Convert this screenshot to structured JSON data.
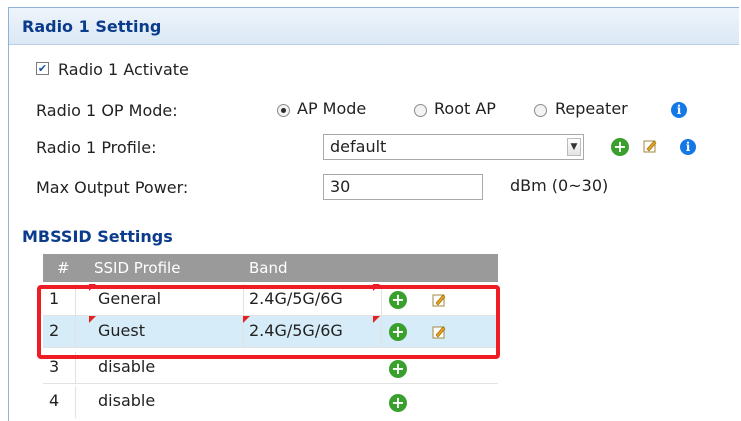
{
  "radio_setting": {
    "title": "Radio 1 Setting",
    "activate_label": "Radio 1 Activate",
    "activate_checked": true,
    "op_mode_label": "Radio 1 OP Mode:",
    "op_mode_options": [
      "AP Mode",
      "Root AP",
      "Repeater"
    ],
    "op_mode_selected": "AP Mode",
    "profile_label": "Radio 1 Profile:",
    "profile_value": "default",
    "power_label": "Max Output Power:",
    "power_value": "30",
    "power_unit": "dBm (0~30)"
  },
  "mbssid": {
    "title": "MBSSID Settings",
    "columns": [
      "#",
      "SSID Profile",
      "Band"
    ],
    "rows": [
      {
        "num": "1",
        "profile": "General",
        "band": "2.4G/5G/6G"
      },
      {
        "num": "2",
        "profile": "Guest",
        "band": "2.4G/5G/6G"
      },
      {
        "num": "3",
        "profile": "disable",
        "band": ""
      },
      {
        "num": "4",
        "profile": "disable",
        "band": ""
      }
    ]
  },
  "colors": {
    "title_blue": "#0b3c8c",
    "info_blue": "#1478e6",
    "add_green": "#3aa02d",
    "highlight_red": "#ee1c25",
    "selected_row": "#d6ecf8"
  },
  "icons": [
    "checkbox-icon",
    "radio-icon",
    "info-icon",
    "add-icon",
    "edit-icon",
    "dropdown-arrow-icon"
  ]
}
